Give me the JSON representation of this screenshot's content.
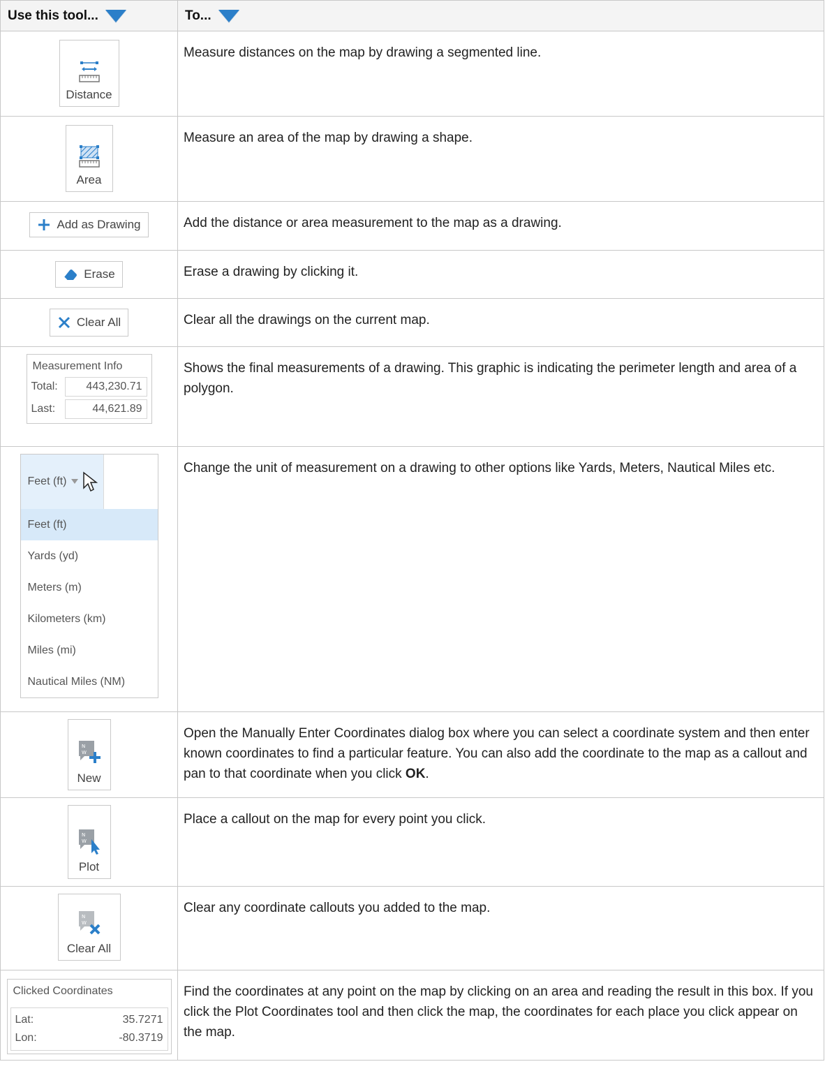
{
  "header": {
    "col1": "Use this tool...",
    "col2": "To..."
  },
  "rows": [
    {
      "tool": {
        "label": "Distance",
        "icon": "ruler-distance-icon"
      },
      "desc": "Measure distances on the map by drawing a segmented line."
    },
    {
      "tool": {
        "label": "Area",
        "icon": "ruler-area-icon"
      },
      "desc": "Measure an area of the map by drawing a shape."
    },
    {
      "tool": {
        "label": "Add as Drawing",
        "icon": "plus-icon"
      },
      "desc": "Add the distance or area measurement to the map as a drawing."
    },
    {
      "tool": {
        "label": "Erase",
        "icon": "eraser-icon"
      },
      "desc": "Erase a drawing by clicking it."
    },
    {
      "tool": {
        "label": "Clear All",
        "icon": "close-icon"
      },
      "desc": "Clear all the drawings on the current map."
    },
    {
      "tool": {
        "title": "Measurement Info",
        "total_label": "Total:",
        "total_value": "443,230.71",
        "last_label": "Last:",
        "last_value": "44,621.89"
      },
      "desc": "Shows the final measurements of a drawing. This graphic is indicating the perimeter length and area of a polygon."
    },
    {
      "tool": {
        "selected": "Feet (ft)",
        "options": [
          "Feet (ft)",
          "Yards (yd)",
          "Meters (m)",
          "Kilometers (km)",
          "Miles (mi)",
          "Nautical Miles (NM)"
        ]
      },
      "desc": "Change the unit of measurement on a drawing to other options like Yards, Meters, Nautical Miles etc."
    },
    {
      "tool": {
        "label": "New",
        "icon": "coordinate-new-icon"
      },
      "desc": "Open the Manually Enter Coordinates dialog box where you can select a coordinate system and then enter known coordinates to find a particular feature. You can also add the coordinate to the map as a callout and pan to that coordinate when you click ",
      "desc_bold": "OK",
      "desc_end": "."
    },
    {
      "tool": {
        "label": "Plot",
        "icon": "coordinate-plot-icon"
      },
      "desc": "Place a callout on the map for every point you click."
    },
    {
      "tool": {
        "label": "Clear All",
        "icon": "coordinate-clear-icon"
      },
      "desc": "Clear any coordinate callouts you added to the map."
    },
    {
      "tool": {
        "title": "Clicked Coordinates",
        "lat_label": "Lat:",
        "lat_value": "35.7271",
        "lon_label": "Lon:",
        "lon_value": "-80.3719"
      },
      "desc": "Find the coordinates at any point on the map by clicking on an area and reading the result in this box. If you click the Plot Coordinates tool and then click the map, the coordinates for each place you click appear on the map."
    }
  ]
}
